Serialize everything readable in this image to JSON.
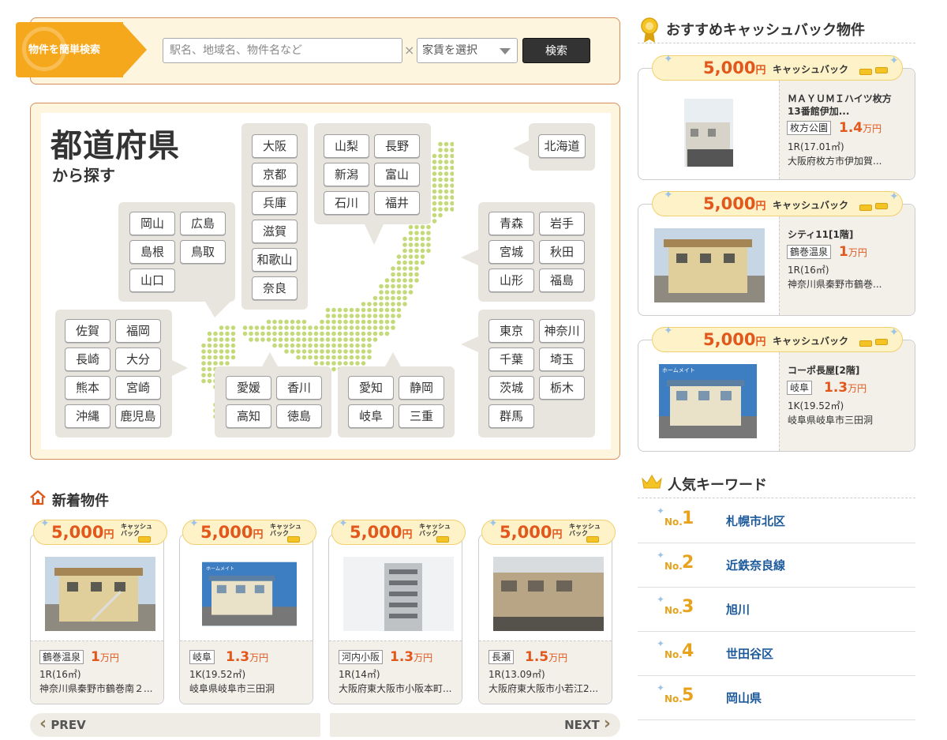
{
  "search": {
    "tag_label": "物件を簡単検索",
    "keyword_placeholder": "駅名、地域名、物件名など",
    "clear_glyph": "×",
    "rent_select": "家賃を選択",
    "submit_label": "検索"
  },
  "prefecture_map": {
    "title": "都道府県",
    "subtitle": "から探す",
    "regions": {
      "kinki": [
        "大阪",
        "京都",
        "兵庫",
        "滋賀",
        "和歌山",
        "奈良"
      ],
      "chubu_north": [
        "山梨",
        "長野",
        "新潟",
        "富山",
        "石川",
        "福井"
      ],
      "hokkaido": [
        "北海道"
      ],
      "chugoku": [
        "岡山",
        "広島",
        "島根",
        "鳥取",
        "山口"
      ],
      "tohoku": [
        "青森",
        "岩手",
        "宮城",
        "秋田",
        "山形",
        "福島"
      ],
      "kyushu": [
        "佐賀",
        "福岡",
        "長崎",
        "大分",
        "熊本",
        "宮崎",
        "沖縄",
        "鹿児島"
      ],
      "shikoku": [
        "愛媛",
        "香川",
        "高知",
        "徳島"
      ],
      "tokai": [
        "愛知",
        "静岡",
        "岐阜",
        "三重"
      ],
      "kanto": [
        "東京",
        "神奈川",
        "千葉",
        "埼玉",
        "茨城",
        "栃木",
        "群馬"
      ]
    }
  },
  "new_listings": {
    "heading": "新着物件",
    "cashback_amount": "5,000",
    "cashback_unit": "円",
    "cashback_label_1": "キャッシュ",
    "cashback_label_2": "バック",
    "items": [
      {
        "station": "鶴巻温泉",
        "price": "1",
        "price_unit": "万円",
        "layout": "1R(16㎡)",
        "address": "神奈川県秦野市鶴巻南２..."
      },
      {
        "station": "岐阜",
        "price": "1.3",
        "price_unit": "万円",
        "layout": "1K(19.52㎡)",
        "address": "岐阜県岐阜市三田洞"
      },
      {
        "station": "河内小阪",
        "price": "1.3",
        "price_unit": "万円",
        "layout": "1R(14㎡)",
        "address": "大阪府東大阪市小阪本町..."
      },
      {
        "station": "長瀬",
        "price": "1.5",
        "price_unit": "万円",
        "layout": "1R(13.09㎡)",
        "address": "大阪府東大阪市小若江2..."
      }
    ],
    "prev_label": "PREV",
    "next_label": "NEXT"
  },
  "recommended": {
    "heading": "おすすめキャッシュバック物件",
    "cashback_amount": "5,000",
    "cashback_unit": "円",
    "cashback_label": "キャッシュバック",
    "items": [
      {
        "name_1": "ＭＡＹＵＭＩハイツ枚方",
        "name_2": "13番館伊加...",
        "station": "枚方公園",
        "price": "1.4",
        "price_unit": "万円",
        "layout": "1R(17.01㎡)",
        "address": "大阪府枚方市伊加賀..."
      },
      {
        "name_1": "シティ11[1階]",
        "name_2": "",
        "station": "鶴巻温泉",
        "price": "1",
        "price_unit": "万円",
        "layout": "1R(16㎡)",
        "address": "神奈川県秦野市鶴巻..."
      },
      {
        "name_1": "コーポ長屋[2階]",
        "name_2": "",
        "station": "岐阜",
        "price": "1.3",
        "price_unit": "万円",
        "layout": "1K(19.52㎡)",
        "address": "岐阜県岐阜市三田洞"
      }
    ]
  },
  "popular_keywords": {
    "heading": "人気キーワード",
    "no_label": "No.",
    "items": [
      {
        "rank": "1",
        "text": "札幌市北区"
      },
      {
        "rank": "2",
        "text": "近鉄奈良線"
      },
      {
        "rank": "3",
        "text": "旭川"
      },
      {
        "rank": "4",
        "text": "世田谷区"
      },
      {
        "rank": "5",
        "text": "岡山県"
      }
    ]
  },
  "photo_caption": "ホームメイト",
  "colors": {
    "accent_orange": "#f6a81c",
    "price_red": "#e2571c",
    "map_green": "#c4da7a",
    "panel_cream": "#fdf5dd",
    "keyword_blue": "#1d5a9c"
  }
}
